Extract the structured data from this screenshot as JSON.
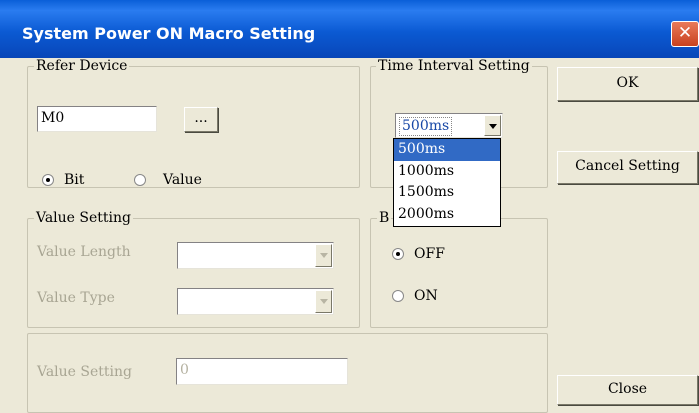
{
  "window": {
    "title": "System Power ON Macro Setting",
    "close_glyph": "✕"
  },
  "refer_device": {
    "legend": "Refer Device",
    "device_value": "M0",
    "browse_label": "...",
    "bit_label": "Bit",
    "value_label": "Value",
    "bit_selected": true
  },
  "time_interval": {
    "legend": "Time Interval Setting",
    "selected": "500ms",
    "options": [
      "500ms",
      "1000ms",
      "1500ms",
      "2000ms"
    ],
    "highlighted_index": 0
  },
  "value_setting_group": {
    "legend": "Value Setting",
    "length_label": "Value Length",
    "type_label": "Value Type"
  },
  "bit_group": {
    "legend": "B",
    "off_label": "OFF",
    "on_label": "ON",
    "off_selected": true
  },
  "value_setting_field": {
    "label": "Value Setting",
    "value": "0"
  },
  "buttons": {
    "ok": "OK",
    "cancel": "Cancel Setting",
    "close": "Close"
  },
  "colors": {
    "title_blue": "#0a5fd8",
    "highlight": "#316ac5",
    "dialog_bg": "#ece9d8"
  }
}
